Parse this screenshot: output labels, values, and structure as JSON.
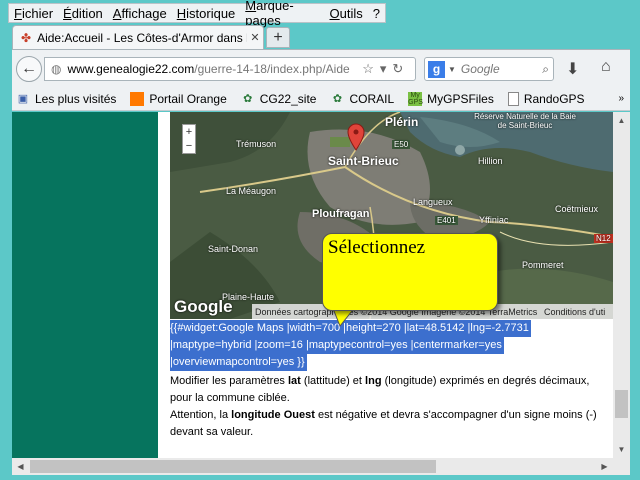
{
  "menu": [
    "Fichier",
    "Édition",
    "Affichage",
    "Historique",
    "Marque-pages",
    "Outils",
    "?"
  ],
  "tab": {
    "title": "Aide:Accueil - Les Côtes-d'Armor dans l...",
    "new_tab_label": "+"
  },
  "url": {
    "domain": "www.genealogie22.com",
    "path": "/guerre-14-18/index.php/Aide"
  },
  "search": {
    "placeholder": "Google",
    "engine_letter": "g"
  },
  "bookmarks": [
    {
      "label": "Les plus visités",
      "icon": "most-visited-icon"
    },
    {
      "label": "Portail Orange",
      "icon": "orange-icon"
    },
    {
      "label": "CG22_site",
      "icon": "cg22-icon"
    },
    {
      "label": "CORAIL",
      "icon": "corail-icon"
    },
    {
      "label": "MyGPSFiles",
      "icon": "mygps-icon"
    },
    {
      "label": "RandoGPS",
      "icon": "page-icon"
    }
  ],
  "map": {
    "labels": [
      "Saint-Brieuc",
      "Plérin",
      "Trémuson",
      "La Méaugon",
      "Ploufragan",
      "Langueux",
      "Yffiniac",
      "Hillion",
      "Coëtmieux",
      "Saint-Donan",
      "Plaine-Haute",
      "Pommeret",
      "Réserve Naturelle de la Baie de Saint-Brieuc",
      "E50",
      "E401",
      "N12"
    ],
    "google_logo": "Google",
    "attribution_left": "Données cartographiques ©2014 Google Imagerie ©2014 TerraMetrics",
    "attribution_right": "Conditions d'uti",
    "zoom_in": "+",
    "zoom_out": "−"
  },
  "callout": {
    "text": "Sélectionnez"
  },
  "selected_code": [
    "{{#widget:Google Maps |width=700 |height=270 |lat=48.5142 |lng=-2.7731",
    "|maptype=hybrid |zoom=16 |maptypecontrol=yes |centermarker=yes",
    "|overviewmapcontrol=yes }}"
  ],
  "body": {
    "p1_before": "Modifier les paramètres ",
    "p1_lat": "lat",
    "p1_mid": " (lattitude) et ",
    "p1_lng": "lng",
    "p1_after": " (longitude) exprimés en degrés décimaux,",
    "p2": "pour la commune ciblée.",
    "p3_before": "Attention, la ",
    "p3_bold": "longitude Ouest",
    "p3_after": " est négative et devra s'accompagner d'un signe moins (-)",
    "p4": "devant sa valeur."
  },
  "colors": {
    "teal_bg": "#5cc8c8",
    "sidebar_green": "#06745e",
    "selection_blue": "#3c6fce",
    "callout_yellow": "#ffff00"
  }
}
